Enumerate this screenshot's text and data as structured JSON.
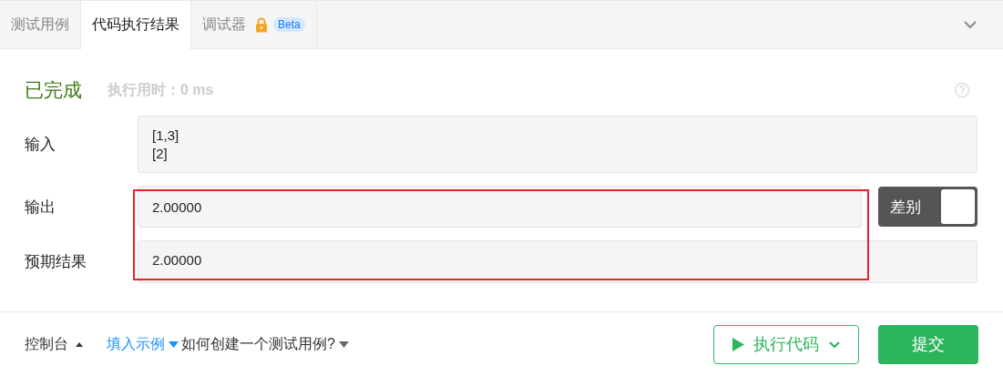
{
  "tabs": [
    {
      "label": "测试用例",
      "selected": false
    },
    {
      "label": "代码执行结果",
      "selected": true
    },
    {
      "label": "调试器",
      "selected": false,
      "locked": true,
      "badge": "Beta"
    }
  ],
  "status": {
    "label": "已完成",
    "runtime": "执行用时：0 ms"
  },
  "rows": [
    {
      "label": "输入",
      "lines": [
        "[1,3]",
        "[2]"
      ]
    },
    {
      "label": "输出",
      "lines": [
        "2.00000"
      ],
      "diff_toggle": {
        "label": "差别",
        "on": true
      }
    },
    {
      "label": "预期结果",
      "lines": [
        "2.00000"
      ]
    }
  ],
  "highlight_frame": true,
  "footer": {
    "console": "控制台",
    "fill_example": "填入示例",
    "help": "如何创建一个测试用例?",
    "run": "执行代码",
    "submit": "提交"
  }
}
